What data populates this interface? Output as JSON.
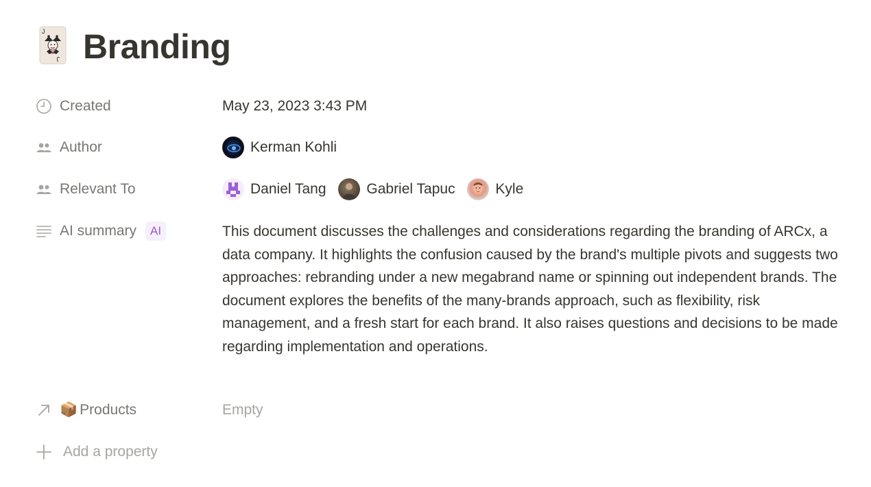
{
  "page": {
    "title": "Branding",
    "icon": "joker-card-icon"
  },
  "properties": {
    "created": {
      "label": "Created",
      "icon": "clock-icon",
      "value": "May 23, 2023 3:43 PM"
    },
    "author": {
      "label": "Author",
      "icon": "people-icon",
      "people": [
        {
          "name": "Kerman Kohli"
        }
      ]
    },
    "relevant_to": {
      "label": "Relevant To",
      "icon": "people-icon",
      "people": [
        {
          "name": "Daniel Tang"
        },
        {
          "name": "Gabriel Tapuc"
        },
        {
          "name": "Kyle"
        }
      ]
    },
    "ai_summary": {
      "label": "AI summary",
      "badge": "AI",
      "icon": "text-lines-icon",
      "value": "This document discusses the challenges and considerations regarding the branding of ARCx, a data company. It highlights the confusion caused by the brand's multiple pivots and suggests two approaches: rebranding under a new megabrand name or spinning out independent brands. The document explores the benefits of the many-brands approach, such as flexibility, risk management, and a fresh start for each brand. It also raises questions and decisions to be made regarding implementation and operations."
    },
    "products": {
      "label": "Products",
      "emoji": "📦",
      "icon": "arrow-up-right-icon",
      "value": "Empty"
    }
  },
  "add_property": {
    "label": "Add a property",
    "icon": "plus-icon"
  },
  "colors": {
    "text": "#37352f",
    "muted": "#787774",
    "placeholder": "#a6a5a1",
    "ai_badge_bg": "#f6f0fb",
    "ai_badge_text": "#9b59c7"
  }
}
